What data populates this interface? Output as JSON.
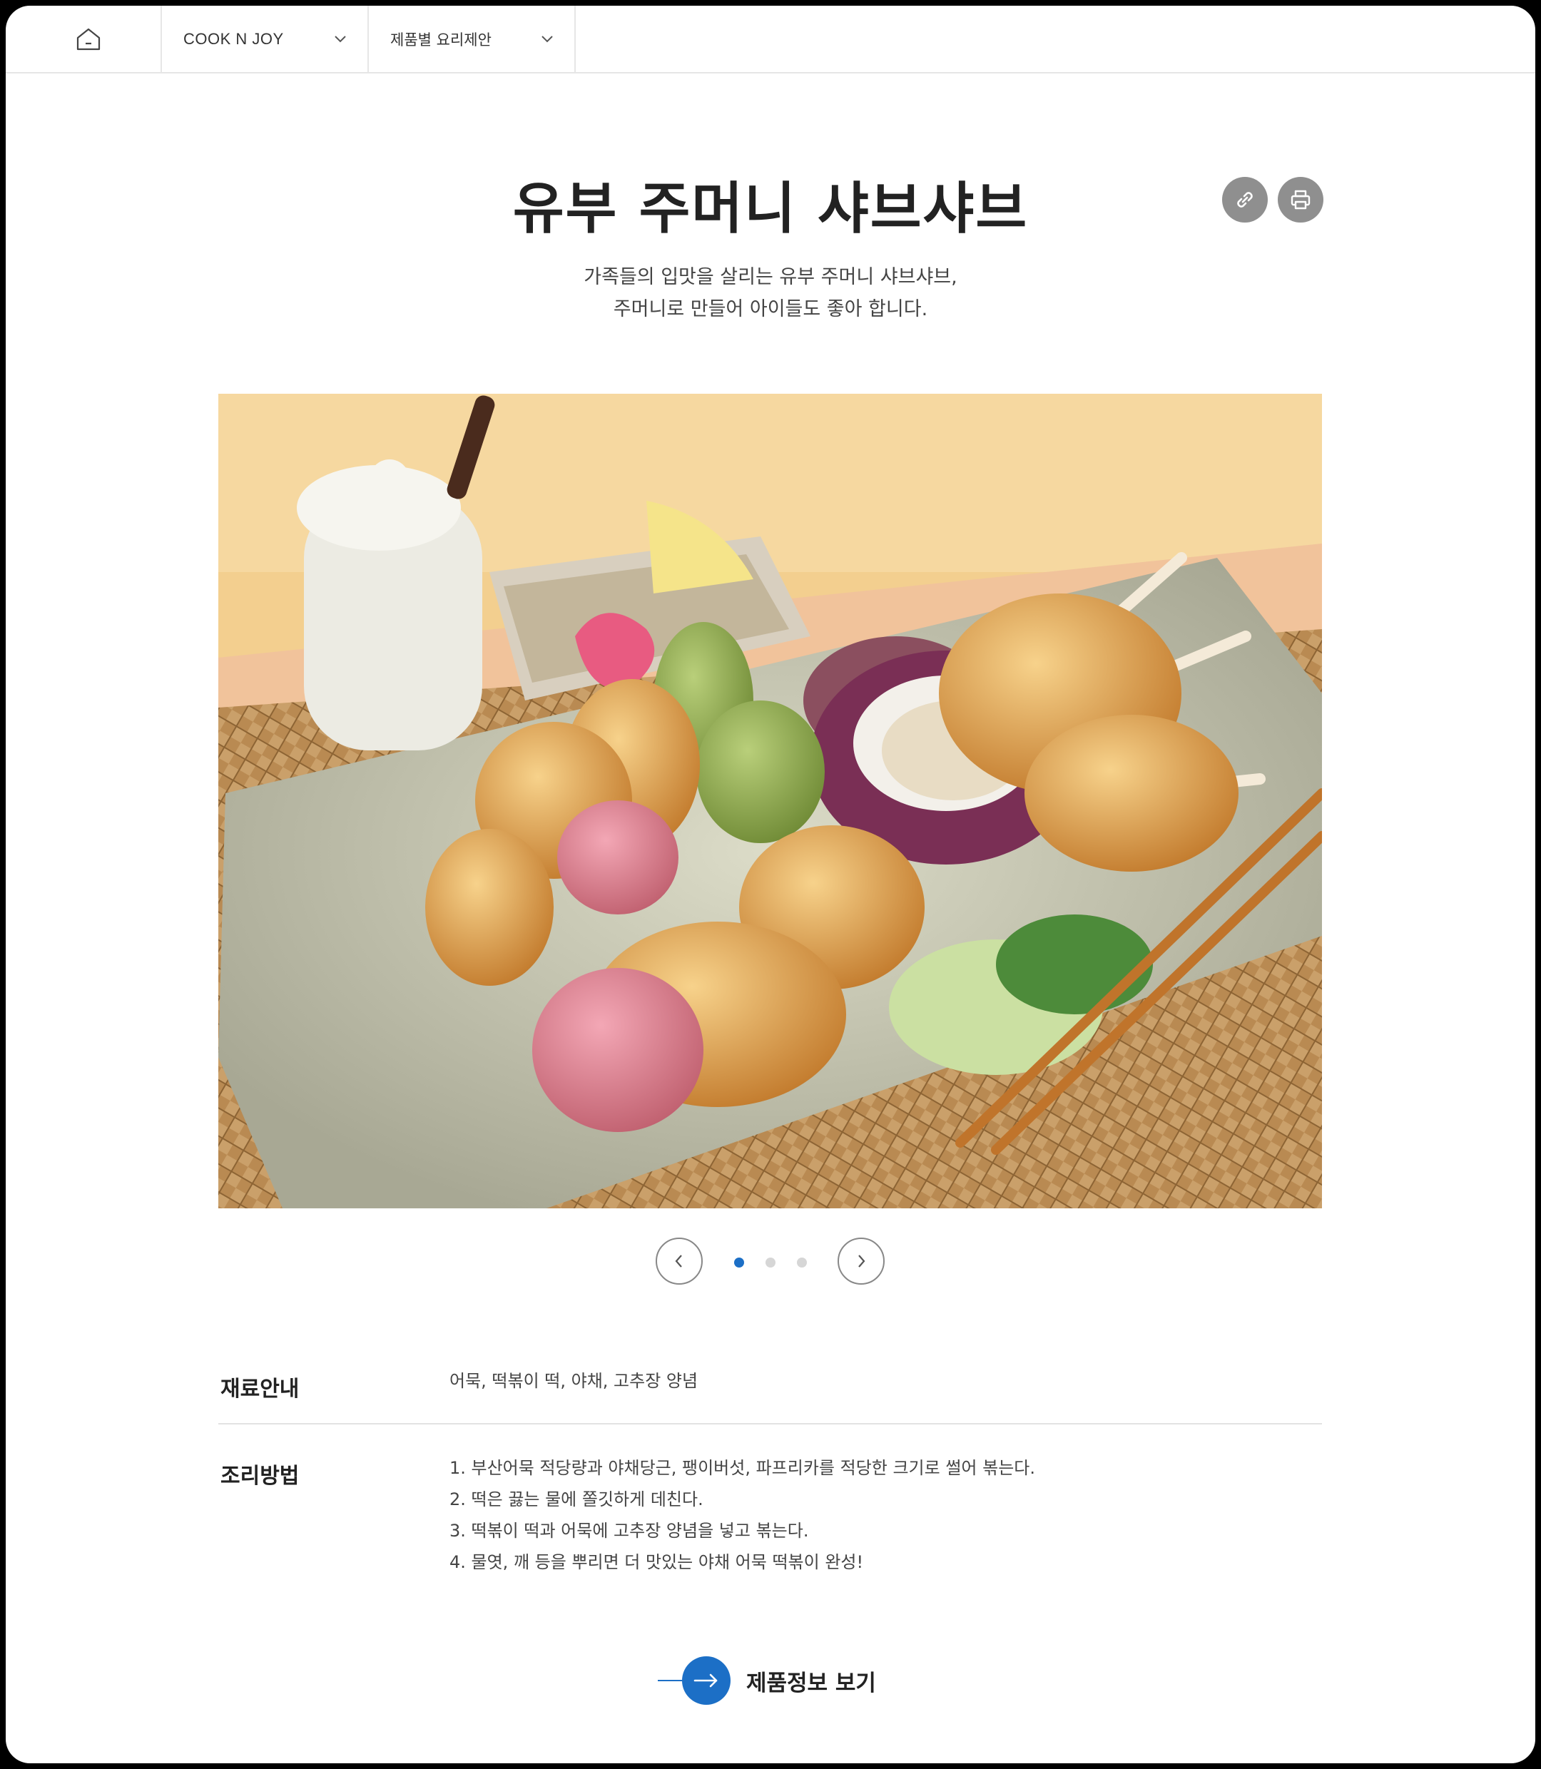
{
  "nav": {
    "brand": "COOK N JOY",
    "category": "제품별 요리제안"
  },
  "recipe": {
    "title": "유부 주머니 샤브샤브",
    "subtitle_line1": "가족들의 입맛을 살리는 유부 주머니 샤브샤브,",
    "subtitle_line2": "주머니로 만들어 아이들도 좋아 합니다."
  },
  "carousel": {
    "total_slides": 3,
    "active_slide": 1
  },
  "ingredients": {
    "label": "재료안내",
    "text": "어묵, 떡볶이 떡, 야채, 고추장 양념"
  },
  "method": {
    "label": "조리방법",
    "steps": [
      "1. 부산어묵 적당량과 야채당근,  팽이버섯, 파프리카를 적당한 크기로 썰어 볶는다.",
      "2. 떡은 끓는 물에 쫄깃하게 데친다.",
      "3. 떡볶이 떡과 어묵에 고추장 양념을 넣고 볶는다.",
      "4. 물엿, 깨 등을 뿌리면 더 맛있는 야채 어묵 떡볶이 완성!"
    ]
  },
  "product_link": {
    "label": "제품정보 보기"
  },
  "colors": {
    "accent": "#1c6fc6",
    "icon_grey": "#8f8f8f"
  }
}
